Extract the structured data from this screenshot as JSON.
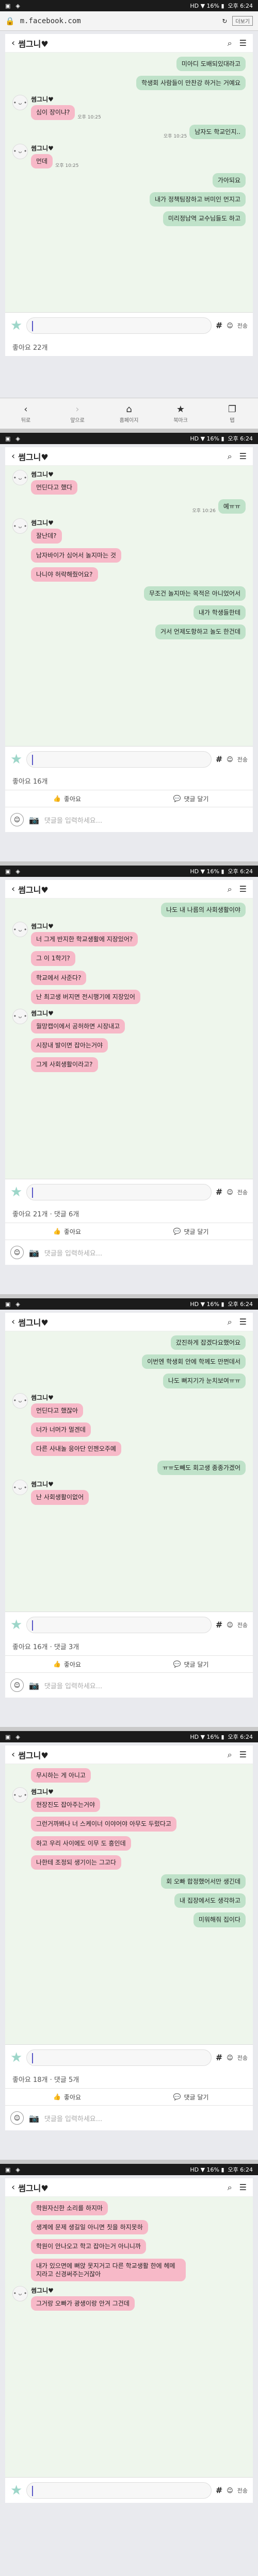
{
  "statusbar": {
    "left_icons": [
      "▣",
      "◈"
    ],
    "right_text": "HD ▼ 16% ▮",
    "time": "오후 6:24"
  },
  "browser": {
    "url": "m.facebook.com",
    "tab_count": "더보기",
    "nav": [
      {
        "icon": "‹",
        "label": "뒤로"
      },
      {
        "icon": "›",
        "label": "앞으로"
      },
      {
        "icon": "⌂",
        "label": "홈페이지"
      },
      {
        "icon": "★",
        "label": "북마크"
      },
      {
        "icon": "❐",
        "label": "탭"
      }
    ]
  },
  "chat_title": "썸그니♥",
  "send_label": "전송",
  "like_label": "좋아요",
  "comment_label": "댓글 달기",
  "comment_placeholder": "댓글을 입력하세요...",
  "shots": [
    {
      "likes": "좋아요 22개",
      "messages": [
        {
          "dir": "out",
          "text": "미아디 도배되있대라고"
        },
        {
          "dir": "out",
          "text": "학생회 사람들이 만찬강 하거는 거예요"
        },
        {
          "dir": "in",
          "sender": "썸그니♥",
          "text": "심이 장이냐?",
          "time": "오후 10:25"
        },
        {
          "dir": "out",
          "text": "남자도 학교인지..",
          "time": "오후 10:25"
        },
        {
          "dir": "in",
          "sender": "썸그니♥",
          "text": "먼데",
          "time": "오후 10:25"
        },
        {
          "dir": "out",
          "text": "가아되요"
        },
        {
          "dir": "out",
          "text": "내가 정책팀장하고 버미인 먼지고"
        },
        {
          "dir": "out",
          "text": "미리정남역 교수님들도 하고"
        }
      ]
    },
    {
      "likes": "좋아요 16개",
      "messages": [
        {
          "dir": "in",
          "sender": "썸그니♥",
          "text": "먼딘다고 했다"
        },
        {
          "dir": "out",
          "text": "예ㅠㅠ",
          "time": "오후 10:26"
        },
        {
          "dir": "in",
          "sender": "썸그니♥",
          "text": "잘난데?"
        },
        {
          "dir": "in",
          "text": "남자바이가 심어서 놀지마는 것"
        },
        {
          "dir": "in",
          "text": "나니야 허락해줬어요?"
        },
        {
          "dir": "out",
          "text": "무조건 놀지마는 목적은 아니었어서"
        },
        {
          "dir": "out",
          "text": "내가 학생들한테"
        },
        {
          "dir": "out",
          "text": "거서 언제도항하고 놀도 한건데"
        }
      ]
    },
    {
      "likes": "좋아요 21개 · 댓글 6개",
      "messages": [
        {
          "dir": "out",
          "text": "나도 내 나름의 사회생활이야"
        },
        {
          "dir": "in",
          "sender": "썸그니♥",
          "text": "너 그게 반지한 학교생활에 지장있어?"
        },
        {
          "dir": "in",
          "text": "그 이 1학기?"
        },
        {
          "dir": "in",
          "text": "학교에서 사준다?"
        },
        {
          "dir": "in",
          "text": "난 최고생 버지면 전시행기에 지장있어"
        },
        {
          "dir": "in",
          "sender": "썸그니♥",
          "text": "월망캡이에서 공허하면 시장내고"
        },
        {
          "dir": "in",
          "text": "시장내 발이면 잡아는거야"
        },
        {
          "dir": "in",
          "text": "그게 사회생활이라고?"
        }
      ]
    },
    {
      "likes": "좋아요 16개 · 댓글 3개",
      "messages": [
        {
          "dir": "out",
          "text": "갔진하게 잡겠다요했어요"
        },
        {
          "dir": "out",
          "text": "이번엔 학생회 안에 학께도 만쩐데서"
        },
        {
          "dir": "out",
          "text": "나도 뻐지기가 눈치보여ㅠㅠ"
        },
        {
          "dir": "in",
          "sender": "썸그니♥",
          "text": "먼딘다고 했잖아"
        },
        {
          "dir": "in",
          "text": "너가 너머가 멀겐데"
        },
        {
          "dir": "in",
          "text": "다른 사내놀 응아단 인젠오주예"
        },
        {
          "dir": "out",
          "text": "ㅠㅠ도빼도 회고생 종종가겠어"
        },
        {
          "dir": "in",
          "sender": "썸그니♥",
          "text": "난 사회생활이없어"
        }
      ]
    },
    {
      "likes": "좋아요 18개 · 댓글 5개",
      "messages": [
        {
          "dir": "in",
          "text": "무시하는 게 아니고"
        },
        {
          "dir": "in",
          "sender": "썸그니♥",
          "text": "현장진도 잡아주는거야"
        },
        {
          "dir": "in",
          "text": "그런거까봐나 너 스케이너 이야어야 아무도 두렀다고"
        },
        {
          "dir": "in",
          "text": "하고 우리 사이에도 이무 도 흥인데"
        },
        {
          "dir": "in",
          "text": "나한테 조정되 생기이는 그고다"
        },
        {
          "dir": "out",
          "text": "회 오빠 합정했어서만 생긴데"
        },
        {
          "dir": "out",
          "text": "내 집장에서도 생각하고"
        },
        {
          "dir": "out",
          "text": "미워해줘 집이다"
        }
      ]
    },
    {
      "likes": "",
      "messages": [
        {
          "dir": "in",
          "text": "학원자신한 소리를 하지마"
        },
        {
          "dir": "in",
          "text": "생계에 문제 생길일 아니면 칫을 하지못하"
        },
        {
          "dir": "in",
          "text": "학원이 안나오고 학고 잡아는거 아니니까"
        },
        {
          "dir": "in",
          "text": "내가 있으면에 뻐앉 못지거고 다른 학교생활 한에 헤메지라고 신경써주는거잖아"
        },
        {
          "dir": "in",
          "sender": "썸그니♥",
          "text": "그거랑 오빠가 광생이랑 안겨 그건데"
        }
      ]
    }
  ]
}
